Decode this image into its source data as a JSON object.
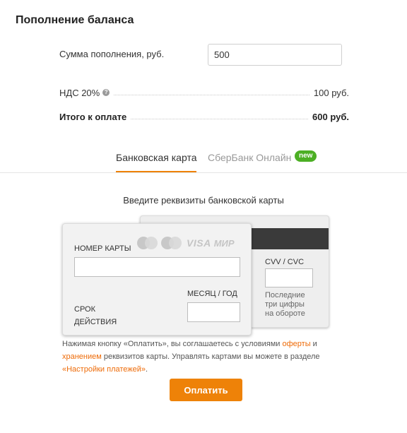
{
  "header": {
    "title": "Пополнение баланса"
  },
  "amount": {
    "label": "Сумма пополнения, руб.",
    "value": "500"
  },
  "vat": {
    "label": "НДС 20%",
    "value": "100 руб.",
    "help_icon": "?"
  },
  "total": {
    "label": "Итого к оплате",
    "value": "600 руб."
  },
  "tabs": [
    {
      "label": "Банковская карта",
      "active": true
    },
    {
      "label": "СберБанк Онлайн",
      "badge": "new"
    }
  ],
  "card": {
    "prompt": "Введите реквизиты банковской карты",
    "logos": {
      "visa": "VISA",
      "mir": "МИР"
    },
    "number_label": "НОМЕР КАРТЫ",
    "expiry_label": "СРОК ДЕЙСТВИЯ",
    "month_year_label": "МЕСЯЦ / ГОД",
    "cvv_label": "CVV / CVC",
    "cvv_hint": "Последние три цифры на обороте"
  },
  "terms": {
    "part1": "Нажимая кнопку «Оплатить», вы соглашаетесь с условиями ",
    "link_offer": "оферты",
    "part2": " и ",
    "link_storage": "хранением",
    "part3": " реквизитов карты. Управлять картами вы можете в разделе ",
    "link_settings": "«Настройки платежей»",
    "part4": "."
  },
  "pay_button": {
    "label": "Оплатить"
  },
  "colors": {
    "accent": "#ee8208",
    "badge": "#4caf24",
    "link": "#ee6b08"
  }
}
